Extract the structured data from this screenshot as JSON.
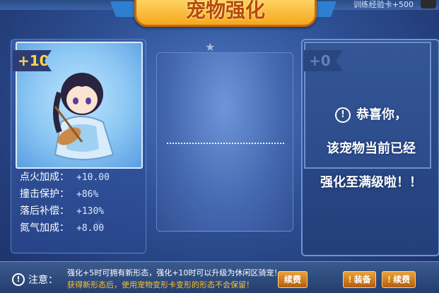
{
  "header": {
    "title": "宠物强化",
    "top_right_text": "训练经验卡+500"
  },
  "pet_card": {
    "level": "+10"
  },
  "stats": [
    {
      "label": "点火加成：",
      "value": "+10.00"
    },
    {
      "label": "撞击保护：",
      "value": "+86%"
    },
    {
      "label": "落后补偿：",
      "value": "+130%"
    },
    {
      "label": "氮气加成：",
      "value": "+8.00"
    }
  ],
  "result_card": {
    "level": "+0"
  },
  "message": {
    "line1": "恭喜你，",
    "line2": "该宠物当前已经",
    "line3": "强化至满级啦！！"
  },
  "footer": {
    "note_label": "注意：",
    "tip1": "强化+5时可拥有新形态，强化+10时可以升级为休闲区骑宠！",
    "tip2": "获得新形态后，使用宠物变形卡变形的形态不会保留！",
    "buttons": {
      "renew_left": "续费",
      "equip": "装备",
      "renew_right": "续费"
    }
  },
  "colors": {
    "accent_gold": "#f6a71b",
    "tip_orange": "#ffc233"
  }
}
